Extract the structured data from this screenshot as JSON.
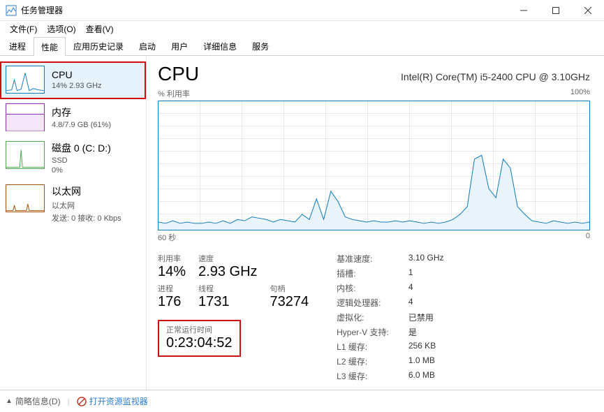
{
  "window": {
    "title": "任务管理器"
  },
  "menu": {
    "file": "文件(F)",
    "options": "选项(O)",
    "view": "查看(V)"
  },
  "tabs": {
    "processes": "进程",
    "performance": "性能",
    "history": "应用历史记录",
    "startup": "启动",
    "users": "用户",
    "details": "详细信息",
    "services": "服务"
  },
  "sidebar": {
    "cpu": {
      "title": "CPU",
      "sub": "14% 2.93 GHz"
    },
    "memory": {
      "title": "内存",
      "sub": "4.8/7.9 GB (61%)"
    },
    "disk": {
      "title": "磁盘 0 (C: D:)",
      "sub1": "SSD",
      "sub2": "0%"
    },
    "ethernet": {
      "title": "以太网",
      "sub1": "以太网",
      "sub2": "发送: 0 接收: 0 Kbps"
    }
  },
  "main": {
    "title": "CPU",
    "model": "Intel(R) Core(TM) i5-2400 CPU @ 3.10GHz",
    "util_label": "% 利用率",
    "util_max": "100%",
    "x_left": "60 秒",
    "x_right": "0",
    "stats": {
      "util_label": "利用率",
      "util_val": "14%",
      "speed_label": "速度",
      "speed_val": "2.93 GHz",
      "proc_label": "进程",
      "proc_val": "176",
      "thread_label": "线程",
      "thread_val": "1731",
      "handle_label": "句柄",
      "handle_val": "73274",
      "uptime_label": "正常运行时间",
      "uptime_val": "0:23:04:52"
    },
    "right": {
      "base_label": "基准速度:",
      "base_val": "3.10 GHz",
      "socket_label": "插槽:",
      "socket_val": "1",
      "core_label": "内核:",
      "core_val": "4",
      "lp_label": "逻辑处理器:",
      "lp_val": "4",
      "virt_label": "虚拟化:",
      "virt_val": "已禁用",
      "hv_label": "Hyper-V 支持:",
      "hv_val": "是",
      "l1_label": "L1 缓存:",
      "l1_val": "256 KB",
      "l2_label": "L2 缓存:",
      "l2_val": "1.0 MB",
      "l3_label": "L3 缓存:",
      "l3_val": "6.0 MB"
    }
  },
  "footer": {
    "brief": "简略信息(D)",
    "resmon": "打开资源监视器"
  },
  "chart_data": {
    "type": "line",
    "title": "% 利用率",
    "xlabel": "60 秒",
    "ylabel": "",
    "ylim": [
      0,
      100
    ],
    "x": [
      0,
      1,
      2,
      3,
      4,
      5,
      6,
      7,
      8,
      9,
      10,
      11,
      12,
      13,
      14,
      15,
      16,
      17,
      18,
      19,
      20,
      21,
      22,
      23,
      24,
      25,
      26,
      27,
      28,
      29,
      30,
      31,
      32,
      33,
      34,
      35,
      36,
      37,
      38,
      39,
      40,
      41,
      42,
      43,
      44,
      45,
      46,
      47,
      48,
      49,
      50,
      51,
      52,
      53,
      54,
      55,
      56,
      57,
      58,
      59,
      60
    ],
    "values": [
      6,
      5,
      7,
      5,
      6,
      5,
      5,
      6,
      5,
      7,
      5,
      8,
      7,
      10,
      9,
      8,
      6,
      8,
      7,
      6,
      12,
      8,
      24,
      8,
      30,
      22,
      10,
      8,
      7,
      6,
      7,
      6,
      6,
      7,
      6,
      7,
      6,
      5,
      6,
      5,
      6,
      8,
      12,
      18,
      55,
      58,
      32,
      25,
      55,
      48,
      18,
      12,
      7,
      6,
      5,
      7,
      6,
      5,
      6,
      5,
      6
    ]
  }
}
